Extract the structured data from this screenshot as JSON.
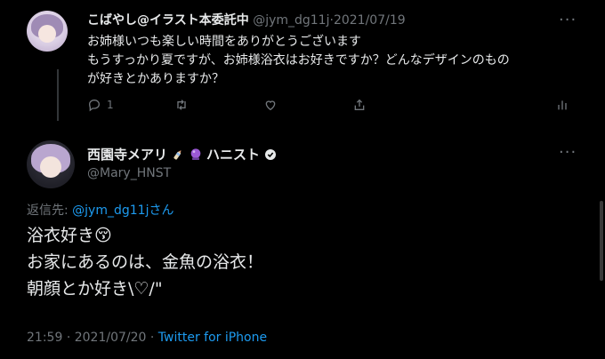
{
  "tweet1": {
    "display_name": "こばやし@イラスト本委託中",
    "handle": "@jym_dg11j",
    "separator": "·",
    "date": "2021/07/19",
    "text_lines": [
      "お姉様いつも楽しい時間をありがとうございます",
      "もうすっかり夏ですが、お姉様浴衣はお好きですか？どんなデザインのもの",
      "が好きとかありますか？"
    ],
    "reply_count": "1"
  },
  "tweet2": {
    "display_name": "西園寺メアリ",
    "name_suffix": "ハニスト",
    "handle": "@Mary_HNST",
    "reply_label": "返信先: ",
    "reply_to": "@jym_dg11jさん",
    "text_lines": [
      "浴衣好き😚",
      "お家にあるのは、金魚の浴衣！",
      "朝顔とか好き\\♡/\""
    ],
    "time": "21:59",
    "date": "2021/07/20",
    "source": "Twitter for iPhone",
    "separator": "·"
  },
  "icons": [
    "more-icon",
    "reply-icon",
    "retweet-icon",
    "like-icon",
    "share-icon",
    "analytics-icon",
    "verified-icon",
    "baby-bottle-icon",
    "crystal-ball-icon"
  ],
  "colors": {
    "background": "#000000",
    "text": "#e7e9ea",
    "muted": "#71767b",
    "link": "#1d9bf0"
  }
}
